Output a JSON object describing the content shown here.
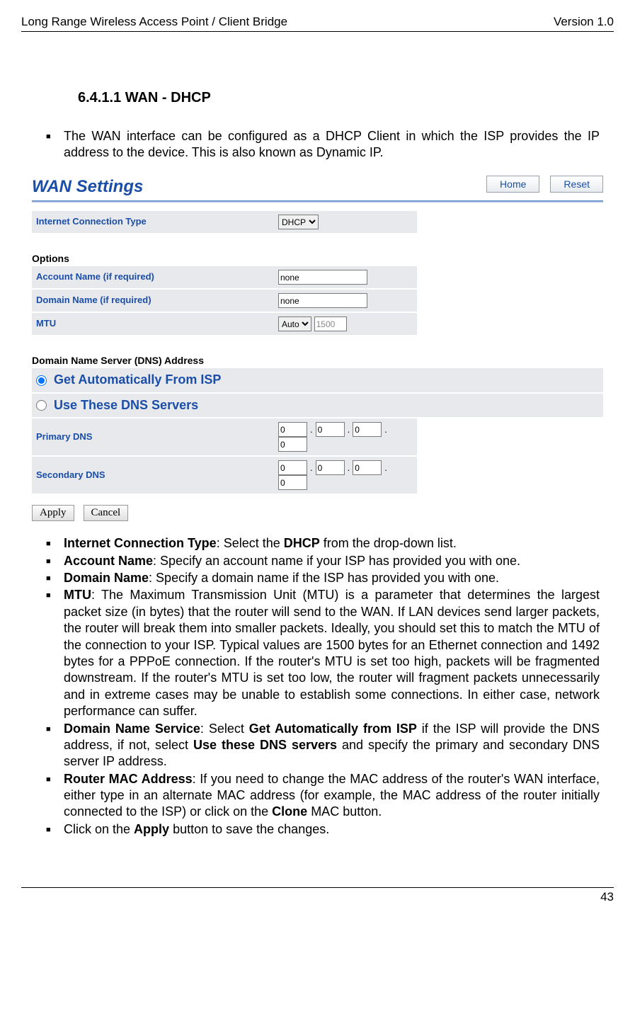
{
  "header": {
    "left": "Long Range Wireless Access Point / Client Bridge",
    "right": "Version 1.0"
  },
  "section": {
    "number_title": "6.4.1.1     WAN - DHCP",
    "intro": "The WAN interface can be configured as a DHCP Client in which the ISP provides the IP address to the device. This is also known as Dynamic IP."
  },
  "panel": {
    "title": "WAN Settings",
    "home": "Home",
    "reset": "Reset",
    "ict_label": "Internet Connection Type",
    "ict_value": "DHCP",
    "options_head": "Options",
    "acct_label": "Account Name (if required)",
    "acct_value": "none",
    "dom_label": "Domain Name (if required)",
    "dom_value": "none",
    "mtu_label": "MTU",
    "mtu_mode": "Auto",
    "mtu_value": "1500",
    "dns_head": "Domain Name Server (DNS) Address",
    "radio1": "Get Automatically From ISP",
    "radio2": "Use These DNS Servers",
    "pdns_label": "Primary DNS",
    "sdns_label": "Secondary DNS",
    "pdns": [
      "0",
      "0",
      "0",
      "0"
    ],
    "sdns": [
      "0",
      "0",
      "0",
      "0"
    ],
    "apply": "Apply",
    "cancel": "Cancel"
  },
  "desc": {
    "b1a": "Internet Connection Type",
    "b1b": ": Select the ",
    "b1c": "DHCP",
    "b1d": " from the drop-down list.",
    "b2a": "Account Name",
    "b2b": ": Specify an account name if your ISP has provided you with one.",
    "b3a": "Domain Name",
    "b3b": ": Specify a domain name if the ISP has provided you with one.",
    "b4a": "MTU",
    "b4b": ": The Maximum Transmission Unit (MTU) is a parameter that determines the largest packet size (in bytes) that the router will send to the WAN. If LAN devices send larger packets, the router will break them into smaller packets. Ideally, you should set this to match the MTU of the connection to your ISP. Typical values are 1500 bytes for an Ethernet connection and 1492 bytes for a PPPoE connection. If the router's MTU is set too high, packets will be fragmented downstream. If the router's MTU is set too low, the router will fragment packets unnecessarily and in extreme cases may be unable to establish some connections. In either case, network performance can suffer.",
    "b5a": "Domain Name Service",
    "b5b": ": Select ",
    "b5c": "Get Automatically from ISP",
    "b5d": " if the ISP will provide the DNS address, if not, select ",
    "b5e": "Use these DNS servers",
    "b5f": " and specify the primary and secondary DNS server IP address.",
    "b6a": "Router MAC Address",
    "b6b": ": If you need to change the MAC address of the router's WAN interface, either type in an alternate MAC address (for example, the MAC address of the router initially connected to the ISP) or click on the ",
    "b6c": "Clone",
    "b6d": " MAC button.",
    "b7a": "Click on the ",
    "b7b": "Apply",
    "b7c": " button to save the changes."
  },
  "footer": {
    "page": "43"
  }
}
